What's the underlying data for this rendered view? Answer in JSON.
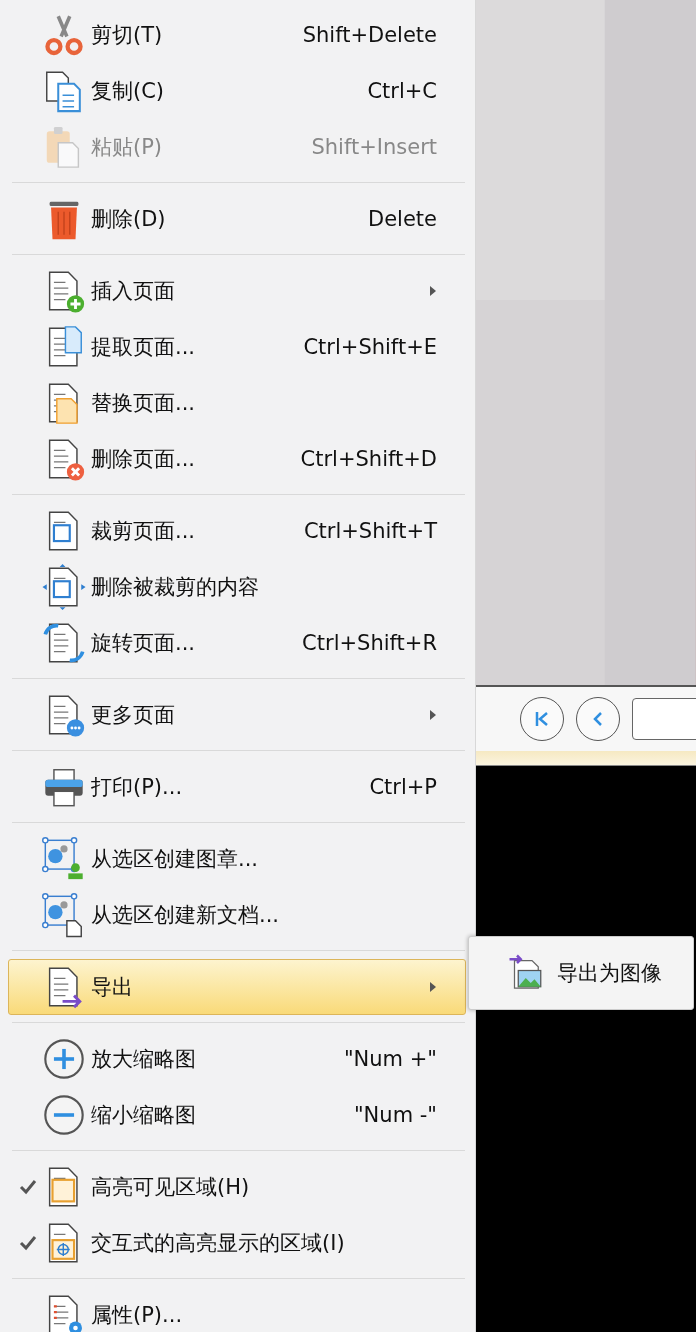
{
  "menu": {
    "groups": [
      [
        {
          "label": "剪切(T)",
          "shortcut": "Shift+Delete",
          "disabled": false,
          "checked": false,
          "selected": false,
          "has_submenu": false
        },
        {
          "label": "复制(C)",
          "shortcut": "Ctrl+C",
          "disabled": false,
          "checked": false,
          "selected": false,
          "has_submenu": false
        },
        {
          "label": "粘贴(P)",
          "shortcut": "Shift+Insert",
          "disabled": true,
          "checked": false,
          "selected": false,
          "has_submenu": false
        }
      ],
      [
        {
          "label": "删除(D)",
          "shortcut": "Delete",
          "disabled": false,
          "checked": false,
          "selected": false,
          "has_submenu": false
        }
      ],
      [
        {
          "label": "插入页面",
          "disabled": false,
          "checked": false,
          "selected": false,
          "has_submenu": true
        },
        {
          "label": "提取页面...",
          "shortcut": "Ctrl+Shift+E",
          "disabled": false,
          "checked": false,
          "selected": false,
          "has_submenu": false
        },
        {
          "label": "替换页面...",
          "disabled": false,
          "checked": false,
          "selected": false,
          "has_submenu": false
        },
        {
          "label": "删除页面...",
          "shortcut": "Ctrl+Shift+D",
          "disabled": false,
          "checked": false,
          "selected": false,
          "has_submenu": false
        }
      ],
      [
        {
          "label": "裁剪页面...",
          "shortcut": "Ctrl+Shift+T",
          "disabled": false,
          "checked": false,
          "selected": false,
          "has_submenu": false
        },
        {
          "label": "删除被裁剪的内容",
          "disabled": false,
          "checked": false,
          "selected": false,
          "has_submenu": false
        },
        {
          "label": "旋转页面...",
          "shortcut": "Ctrl+Shift+R",
          "disabled": false,
          "checked": false,
          "selected": false,
          "has_submenu": false
        }
      ],
      [
        {
          "label": "更多页面",
          "disabled": false,
          "checked": false,
          "selected": false,
          "has_submenu": true
        }
      ],
      [
        {
          "label": "打印(P)...",
          "shortcut": "Ctrl+P",
          "disabled": false,
          "checked": false,
          "selected": false,
          "has_submenu": false
        }
      ],
      [
        {
          "label": "从选区创建图章...",
          "disabled": false,
          "checked": false,
          "selected": false,
          "has_submenu": false
        },
        {
          "label": "从选区创建新文档...",
          "disabled": false,
          "checked": false,
          "selected": false,
          "has_submenu": false
        }
      ],
      [
        {
          "label": "导出",
          "disabled": false,
          "checked": false,
          "selected": true,
          "has_submenu": true
        }
      ],
      [
        {
          "label": "放大缩略图",
          "shortcut": "\"Num +\"",
          "disabled": false,
          "checked": false,
          "selected": false,
          "has_submenu": false
        },
        {
          "label": "缩小缩略图",
          "shortcut": "\"Num -\"",
          "disabled": false,
          "checked": false,
          "selected": false,
          "has_submenu": false
        }
      ],
      [
        {
          "label": "高亮可见区域(H)",
          "disabled": false,
          "checked": true,
          "selected": false,
          "has_submenu": false
        },
        {
          "label": "交互式的高亮显示的区域(I)",
          "disabled": false,
          "checked": true,
          "selected": false,
          "has_submenu": false
        }
      ],
      [
        {
          "label": "属性(P)...",
          "disabled": false,
          "checked": false,
          "selected": false,
          "has_submenu": false
        }
      ]
    ]
  },
  "submenu": {
    "items": [
      {
        "label": "导出为图像"
      }
    ]
  }
}
